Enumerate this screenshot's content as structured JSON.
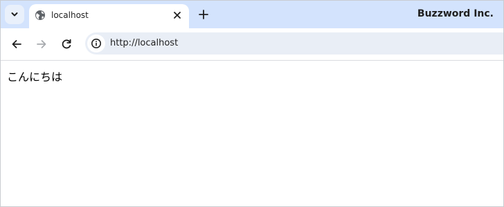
{
  "browser": {
    "tab": {
      "title": "localhost",
      "favicon": "globe-icon",
      "close_icon": "close-icon"
    },
    "tab_search_icon": "chevron-down-icon",
    "new_tab_icon": "plus-icon",
    "profile_label": "Buzzword Inc.",
    "toolbar": {
      "back_icon": "arrow-left-icon",
      "forward_icon": "arrow-right-icon",
      "reload_icon": "reload-icon",
      "site_info_icon": "info-icon",
      "url": "http://localhost"
    }
  },
  "page": {
    "text": "こんにちは"
  },
  "colors": {
    "tabstrip": "#d3e3fd",
    "omnibox": "#e9eef6",
    "text": "#1f1f1f",
    "disabled": "#a8abaf"
  }
}
